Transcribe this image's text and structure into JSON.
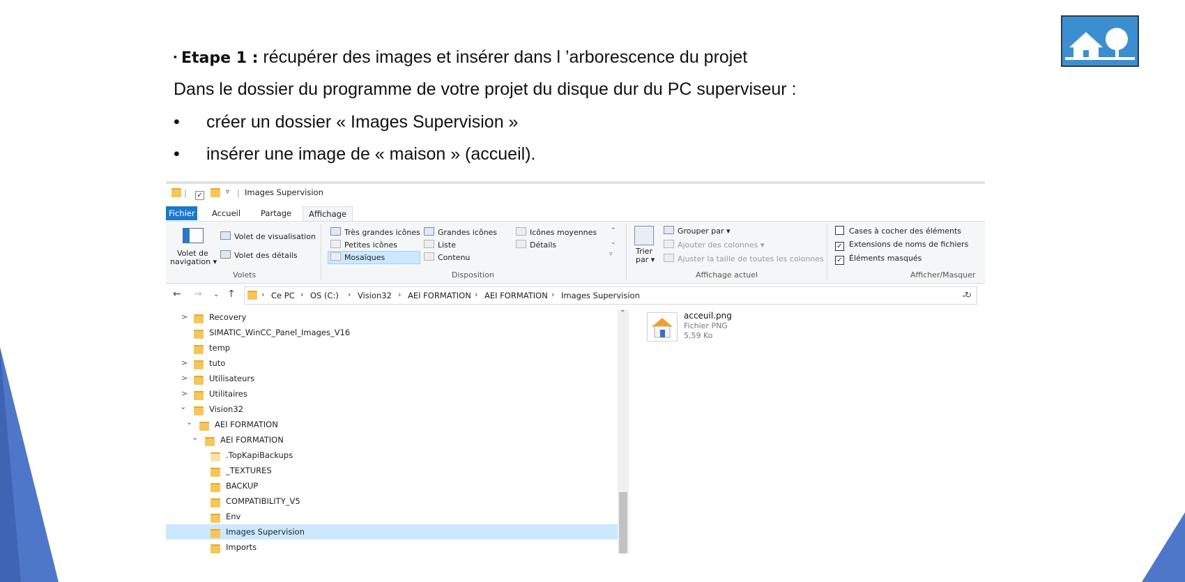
{
  "slide": {
    "bullet_square": "▪",
    "step_label": "Etape 1  :",
    "step_text": " récupérer des images et insérer dans l ’arborescence du projet",
    "intro": "Dans le dossier du programme de votre projet du disque dur du PC superviseur :",
    "bullet_char": "•",
    "bullets": [
      "créer un dossier « Images Supervision »",
      "insérer une image de « maison » (accueil)."
    ]
  },
  "explorer": {
    "title": "Images Supervision",
    "tabs": [
      "Fichier",
      "Accueil",
      "Partage",
      "Affichage"
    ],
    "ribbon": {
      "volets": {
        "nav_pane_line1": "Volet de",
        "nav_pane_line2": "navigation ▾",
        "preview": "Volet de visualisation",
        "details": "Volet des détails",
        "group": "Volets"
      },
      "disposition": {
        "items": [
          "Très grandes icônes",
          "Grandes icônes",
          "Icônes moyennes",
          "Petites icônes",
          "Liste",
          "Détails",
          "Mosaïques",
          "Contenu"
        ],
        "group": "Disposition"
      },
      "affichage_actuel": {
        "sort_line1": "Trier",
        "sort_line2": "par ▾",
        "group_by": "Grouper par ▾",
        "add_columns": "Ajouter des colonnes ▾",
        "fit_columns": "Ajuster la taille de toutes les colonnes",
        "group": "Affichage actuel"
      },
      "afficher_masquer": {
        "checkboxes": [
          {
            "label": "Cases à cocher des éléments",
            "checked": false
          },
          {
            "label": "Extensions de noms de fichiers",
            "checked": true
          },
          {
            "label": "Éléments masqués",
            "checked": true
          }
        ],
        "group": "Afficher/Masquer"
      }
    },
    "address": {
      "crumbs": [
        "Ce PC",
        "OS (C:)",
        "Vision32",
        "AEI FORMATION",
        "AEI FORMATION",
        "Images Supervision"
      ]
    },
    "tree": [
      {
        "label": "Recovery",
        "expander": ">"
      },
      {
        "label": "SIMATIC_WinCC_Panel_Images_V16",
        "expander": ""
      },
      {
        "label": "temp",
        "expander": ""
      },
      {
        "label": "tuto",
        "expander": ">"
      },
      {
        "label": "Utilisateurs",
        "expander": ">"
      },
      {
        "label": "Utilitaires",
        "expander": ">"
      },
      {
        "label": "Vision32",
        "expander": "⌄"
      },
      {
        "label": "AEI FORMATION",
        "expander": "⌄"
      },
      {
        "label": "AEI FORMATION",
        "expander": "⌄"
      },
      {
        "label": ".TopKapiBackups",
        "expander": ""
      },
      {
        "label": "_TEXTURES",
        "expander": ""
      },
      {
        "label": "BACKUP",
        "expander": ""
      },
      {
        "label": "COMPATIBILITY_V5",
        "expander": ""
      },
      {
        "label": "Env",
        "expander": ""
      },
      {
        "label": "Images Supervision",
        "expander": ""
      },
      {
        "label": "Imports",
        "expander": ""
      }
    ],
    "file": {
      "name": "acceuil.png",
      "type": "Fichier PNG",
      "size": "5,59 Ko"
    }
  },
  "colors": {
    "accent_blue": "#1979ca",
    "selection": "#cce8ff",
    "folder": "#f5c65a",
    "triangle": "#4f77c9"
  }
}
